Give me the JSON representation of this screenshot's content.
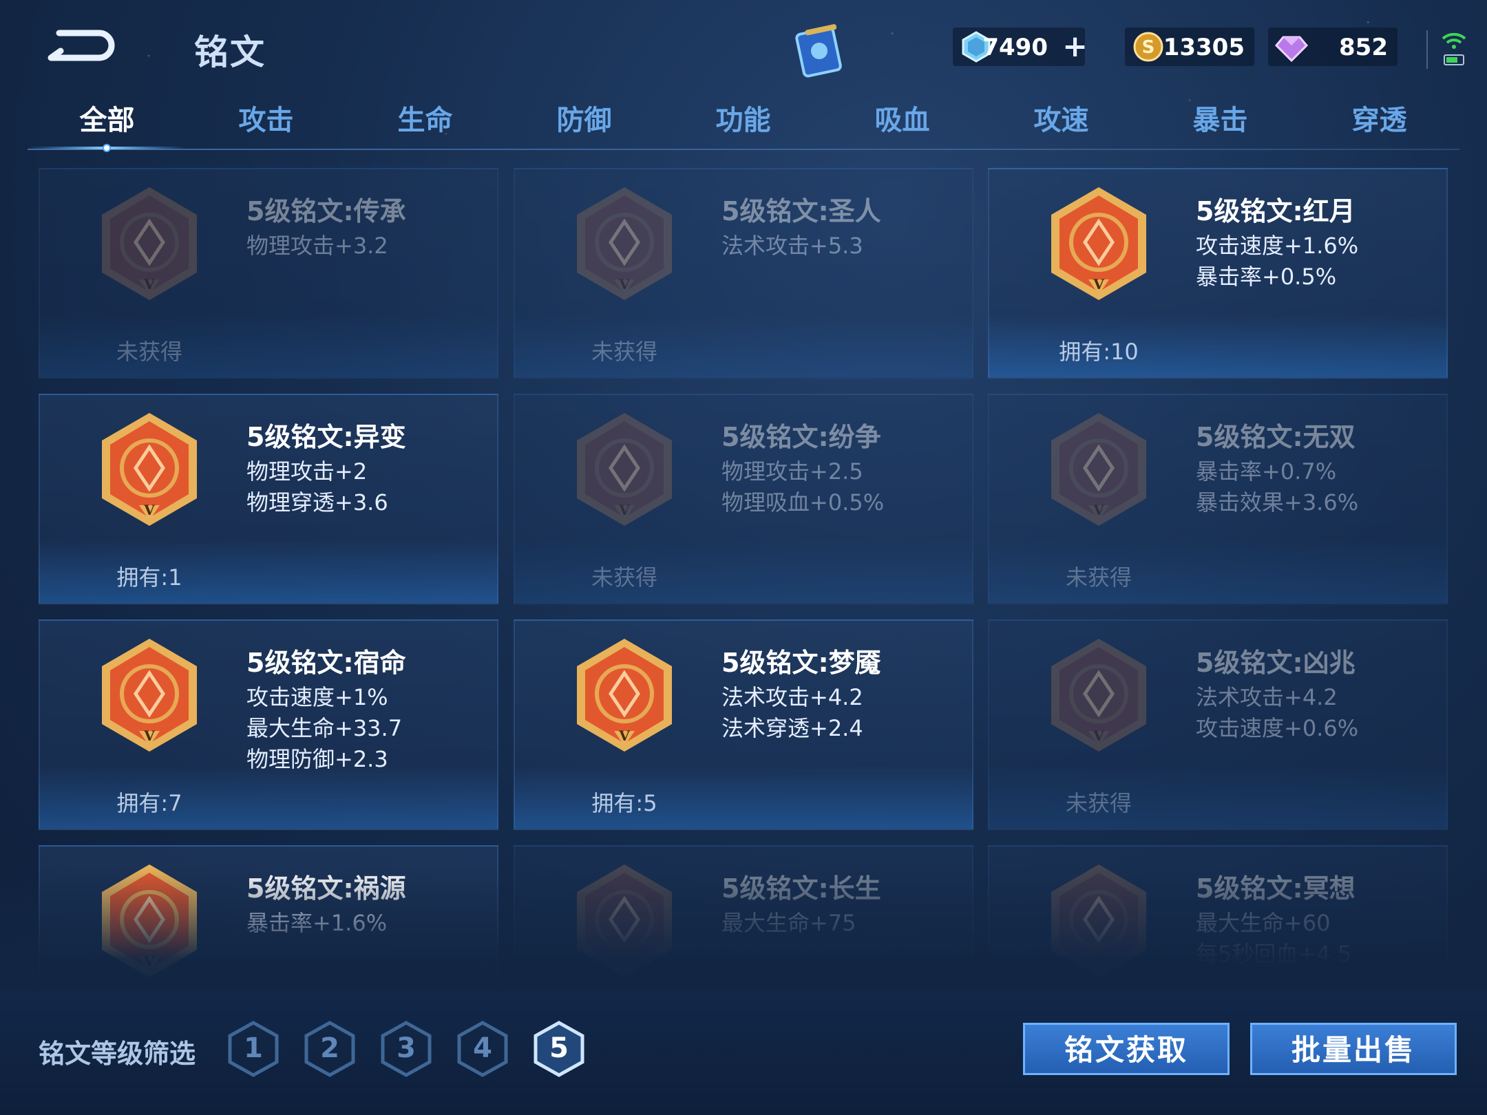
{
  "header": {
    "title": "铭文",
    "currencies": [
      {
        "icon": "crystal-icon",
        "value": "7490",
        "has_plus": true
      },
      {
        "icon": "gold-coin-icon",
        "value": "13305",
        "has_plus": false
      },
      {
        "icon": "diamond-icon",
        "value": "852",
        "has_plus": false
      }
    ]
  },
  "tabs": [
    "全部",
    "攻击",
    "生命",
    "防御",
    "功能",
    "吸血",
    "攻速",
    "暴击",
    "穿透"
  ],
  "active_tab": 0,
  "inscriptions": [
    {
      "name": "5级铭文:传承",
      "stats": [
        "物理攻击+3.2"
      ],
      "status": "未获得",
      "owned": false,
      "icon": "inheritance-emblem-icon"
    },
    {
      "name": "5级铭文:圣人",
      "stats": [
        "法术攻击+5.3"
      ],
      "status": "未获得",
      "owned": false,
      "icon": "sage-emblem-icon"
    },
    {
      "name": "5级铭文:红月",
      "stats": [
        "攻击速度+1.6%",
        "暴击率+0.5%"
      ],
      "status": "拥有:10",
      "owned": true,
      "icon": "red-moon-emblem-icon"
    },
    {
      "name": "5级铭文:异变",
      "stats": [
        "物理攻击+2",
        "物理穿透+3.6"
      ],
      "status": "拥有:1",
      "owned": true,
      "icon": "mutation-emblem-icon"
    },
    {
      "name": "5级铭文:纷争",
      "stats": [
        "物理攻击+2.5",
        "物理吸血+0.5%"
      ],
      "status": "未获得",
      "owned": false,
      "icon": "strife-emblem-icon"
    },
    {
      "name": "5级铭文:无双",
      "stats": [
        "暴击率+0.7%",
        "暴击效果+3.6%"
      ],
      "status": "未获得",
      "owned": false,
      "icon": "peerless-emblem-icon"
    },
    {
      "name": "5级铭文:宿命",
      "stats": [
        "攻击速度+1%",
        "最大生命+33.7",
        "物理防御+2.3"
      ],
      "status": "拥有:7",
      "owned": true,
      "icon": "fate-emblem-icon"
    },
    {
      "name": "5级铭文:梦魇",
      "stats": [
        "法术攻击+4.2",
        "法术穿透+2.4"
      ],
      "status": "拥有:5",
      "owned": true,
      "icon": "nightmare-emblem-icon"
    },
    {
      "name": "5级铭文:凶兆",
      "stats": [
        "法术攻击+4.2",
        "攻击速度+0.6%"
      ],
      "status": "未获得",
      "owned": false,
      "icon": "omen-emblem-icon"
    },
    {
      "name": "5级铭文:祸源",
      "stats": [
        "暴击率+1.6%"
      ],
      "status": "",
      "owned": true,
      "icon": "calamity-emblem-icon"
    },
    {
      "name": "5级铭文:长生",
      "stats": [
        "最大生命+75"
      ],
      "status": "",
      "owned": false,
      "icon": "longevity-emblem-icon"
    },
    {
      "name": "5级铭文:冥想",
      "stats": [
        "最大生命+60",
        "每5秒回血+4.5"
      ],
      "status": "",
      "owned": false,
      "icon": "meditation-emblem-icon"
    }
  ],
  "footer": {
    "filter_label": "铭文等级筛选",
    "levels": [
      "1",
      "2",
      "3",
      "4",
      "5"
    ],
    "active_level": "5",
    "get_button": "铭文获取",
    "sell_button": "批量出售"
  },
  "colors": {
    "owned_emblem": "#e2582e",
    "owned_rim": "#e8b25a",
    "locked_emblem": "#7a4a4a",
    "button_blue": "#2f6fc5",
    "tab_inactive": "#69a7e8"
  }
}
